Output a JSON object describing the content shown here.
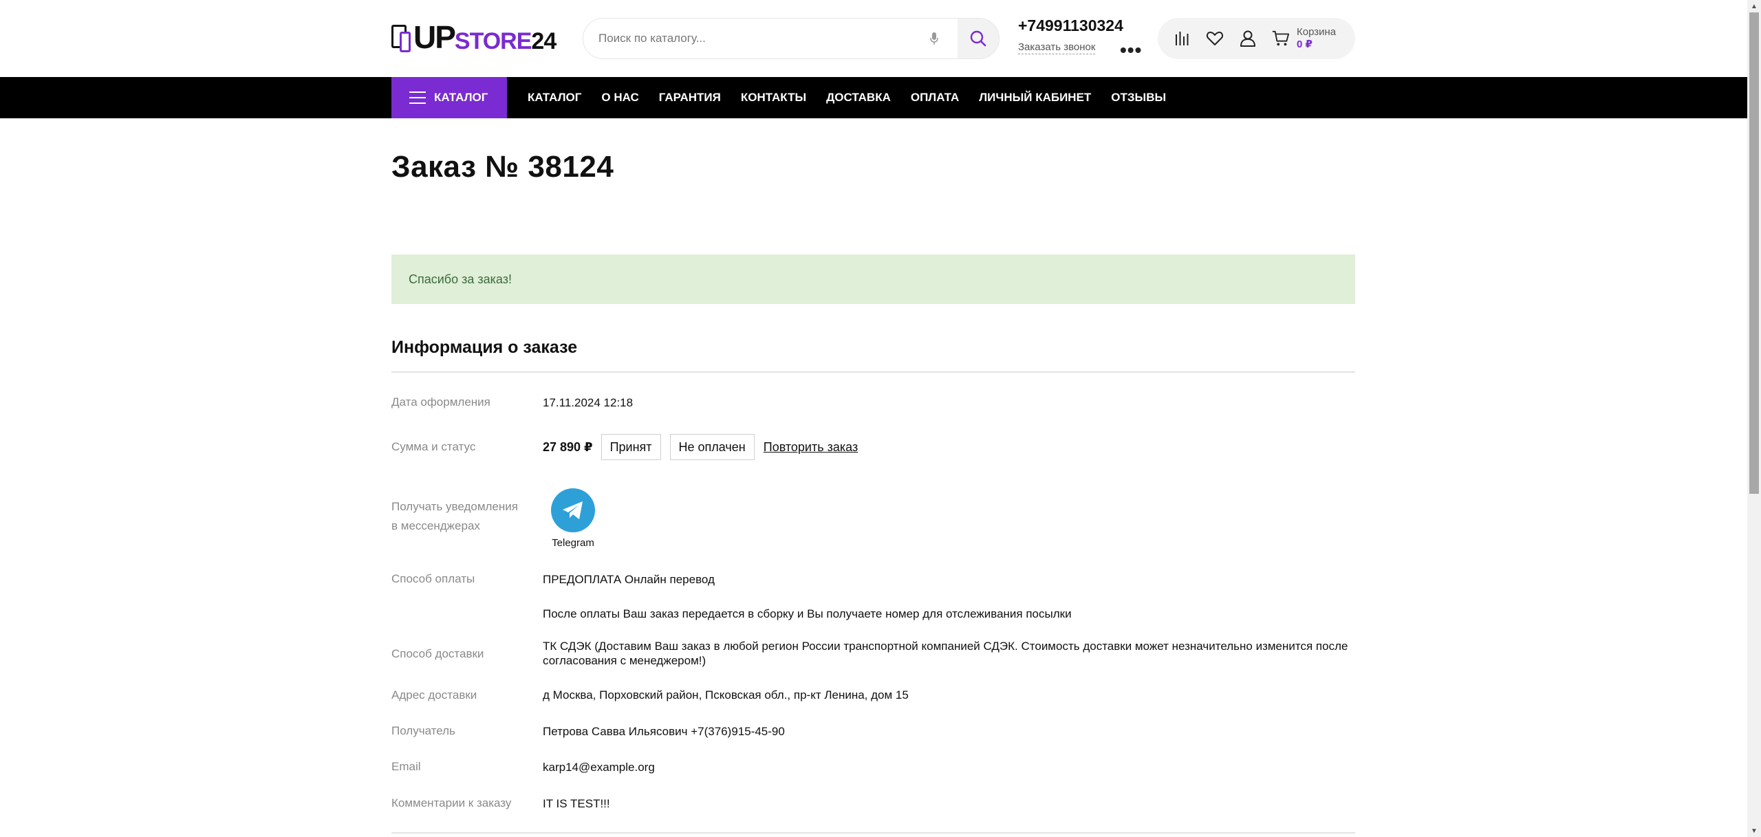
{
  "header": {
    "logo": {
      "part1": "UP",
      "part2": "STORE",
      "part3": "24"
    },
    "search": {
      "placeholder": "Поиск по каталогу..."
    },
    "phone": "+74991130324",
    "callback": "Заказать звонок",
    "more": "•••",
    "cart": {
      "label": "Корзина",
      "sum": "0 ₽"
    }
  },
  "nav": {
    "catalog_button": "КАТАЛОГ",
    "links": [
      "КАТАЛОГ",
      "О НАС",
      "ГАРАНТИЯ",
      "КОНТАКТЫ",
      "ДОСТАВКА",
      "ОПЛАТА",
      "ЛИЧНЫЙ КАБИНЕТ",
      "ОТЗЫВЫ"
    ]
  },
  "page": {
    "title": "Заказ № 38124",
    "alert": "Спасибо за заказ!",
    "section_title": "Информация о заказе"
  },
  "order": {
    "date_label": "Дата оформления",
    "date_value": "17.11.2024 12:18",
    "sum_label": "Сумма и статус",
    "sum_value": "27 890 ₽",
    "status_accepted": "Принят",
    "status_payment": "Не оплачен",
    "repeat_link": "Повторить заказ",
    "notify_label_1": "Получать уведомления",
    "notify_label_2": "в мессенджерах",
    "telegram_label": "Telegram",
    "payment_label": "Способ оплаты",
    "payment_value": "ПРЕДОПЛАТА Онлайн перевод",
    "payment_note": "После оплаты Ваш заказ передается в сборку и Вы получаете номер для отслеживания посылки",
    "delivery_label": "Способ доставки",
    "delivery_value": "ТК СДЭК (Доставим Ваш заказ в любой регион России транспортной компанией СДЭК. Стоимость доставки может незначительно изменится после согласования с менеджером!)",
    "address_label": "Адрес доставки",
    "address_value": "д Москва, Порховский район, Псковская обл., пр-кт Ленина, дом 15",
    "recipient_label": "Получатель",
    "recipient_value": "Петрова Савва Ильясович +7(376)915-45-90",
    "email_label": "Email",
    "email_value": "karp14@example.org",
    "comment_label": "Комментарии к заказу",
    "comment_value": "IT IS TEST!!!"
  },
  "colors": {
    "accent": "#7a2bd1",
    "nav_bg": "#000000",
    "alert_bg": "#e0efd8",
    "alert_text": "#3c6b3c",
    "telegram": "#2ea0d8"
  },
  "icons": [
    "mic-icon",
    "search-icon",
    "compare-icon",
    "heart-icon",
    "user-icon",
    "cart-icon",
    "menu-icon",
    "telegram-icon"
  ]
}
